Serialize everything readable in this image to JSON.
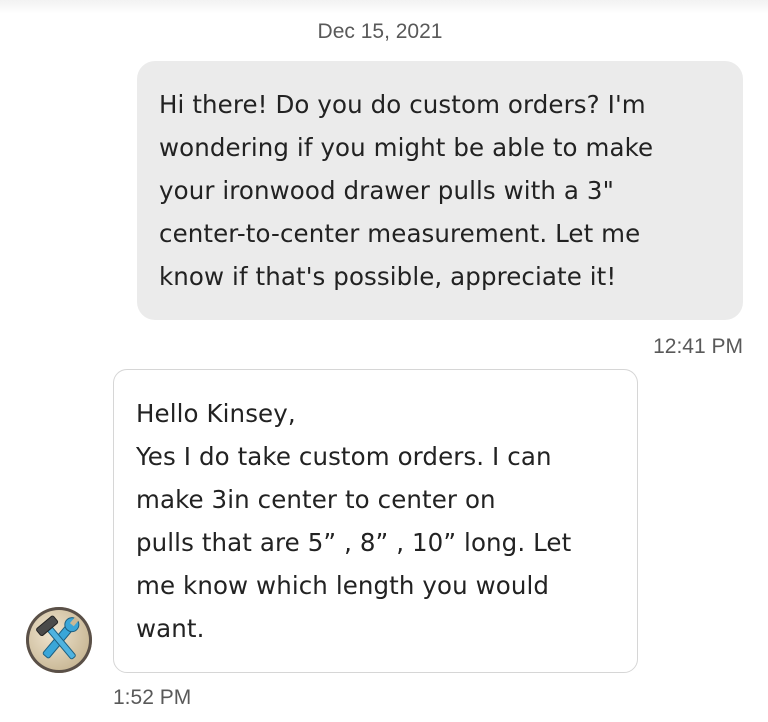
{
  "conversation": {
    "date_separator": "Dec 15, 2021",
    "messages": [
      {
        "direction": "outgoing",
        "text": "Hi there! Do you do custom orders? I'm\nwondering if you might be able to make\nyour ironwood drawer pulls with a 3\"\ncenter-to-center measurement. Let me\nknow if that's possible, appreciate it!",
        "time": "12:41 PM"
      },
      {
        "direction": "incoming",
        "text": "Hello Kinsey,\nYes I do take custom orders. I can\nmake 3in center to center on\npulls that are 5” , 8” , 10” long. Let\nme know which length you would\nwant.",
        "time": "1:52 PM",
        "avatar_icon": "hammer-wrench-icon"
      }
    ]
  },
  "colors": {
    "outgoing_bubble": "#ebebeb",
    "incoming_border": "#d6d6d6",
    "meta_text": "#595959",
    "body_text": "#222222"
  }
}
